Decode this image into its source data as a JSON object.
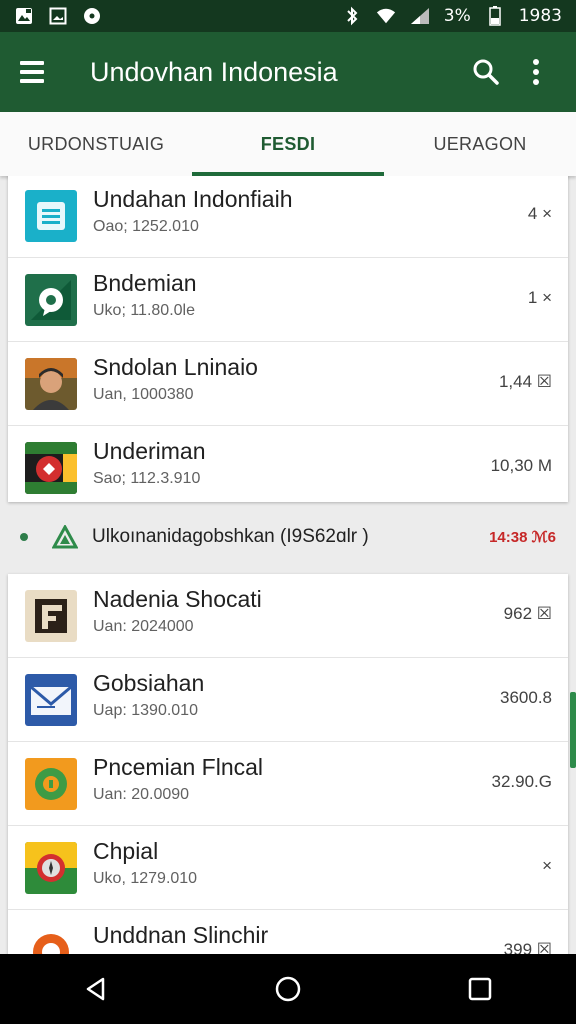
{
  "status_bar": {
    "battery_percent": "3%",
    "time": "1983",
    "left_icons": [
      "image-icon",
      "gallery-icon",
      "circle-notification-icon"
    ],
    "right_icons": [
      "bluetooth-icon",
      "wifi-icon",
      "signal-icon",
      "battery-icon"
    ]
  },
  "app_bar": {
    "title": "Undovhan Indonesia",
    "menu_icon": "hamburger-menu-icon",
    "search_icon": "search-icon",
    "more_icon": "more-vertical-icon"
  },
  "tabs": [
    {
      "label": "URDONSTUAIG",
      "active": false
    },
    {
      "label": "FESDI",
      "active": true
    },
    {
      "label": "UERAGON",
      "active": false
    }
  ],
  "group1": {
    "items": [
      {
        "name": "Undahan Indonfiaih",
        "sub": "Oao; 1252.010",
        "size": "4 ×",
        "icon": "document-icon"
      },
      {
        "name": "Bndemian",
        "sub": "Uko; 11.80.0le",
        "size": "1 ×",
        "icon": "chat-bubble-icon"
      },
      {
        "name": "Sndolan Lninaio",
        "sub": "Uan, 1000380",
        "size": "1,44 ☒",
        "icon": "person-photo-icon"
      },
      {
        "name": "Underiman",
        "sub": "Sao; 112.3.910",
        "size": "10,30 M",
        "icon": "flag-emblem-icon"
      }
    ]
  },
  "section": {
    "label": "Ulkoınanidagobshkan (I9S62ɑlr )",
    "total": "14:38 ℳ6",
    "icon": "green-triangle-icon"
  },
  "group2": {
    "items": [
      {
        "name": "Nadenia Shocati",
        "sub": "Uan: 2024000",
        "size": "962 ☒",
        "icon": "letter-f-icon"
      },
      {
        "name": "Gobsiahan",
        "sub": "Uap: 1390.010",
        "size": "3600.8",
        "icon": "mail-envelope-icon"
      },
      {
        "name": "Pncemian Flncal",
        "sub": "Uan: 20.0090",
        "size": "32.90.G",
        "icon": "gear-badge-icon"
      },
      {
        "name": "Chpial",
        "sub": "Uko, 1279.010",
        "size": "×",
        "icon": "compass-icon"
      },
      {
        "name": "Unddnan Slinchir",
        "sub": "",
        "size": "399 ☒",
        "icon": "orange-gear-icon"
      }
    ]
  },
  "nav_bar": {
    "back_icon": "back-triangle-icon",
    "home_icon": "home-circle-icon",
    "recents_icon": "recents-square-icon"
  },
  "colors": {
    "app_bar": "#1f5b32",
    "status_bar": "#14381f",
    "accent": "#1f6b3a",
    "section_total": "#c62828"
  }
}
